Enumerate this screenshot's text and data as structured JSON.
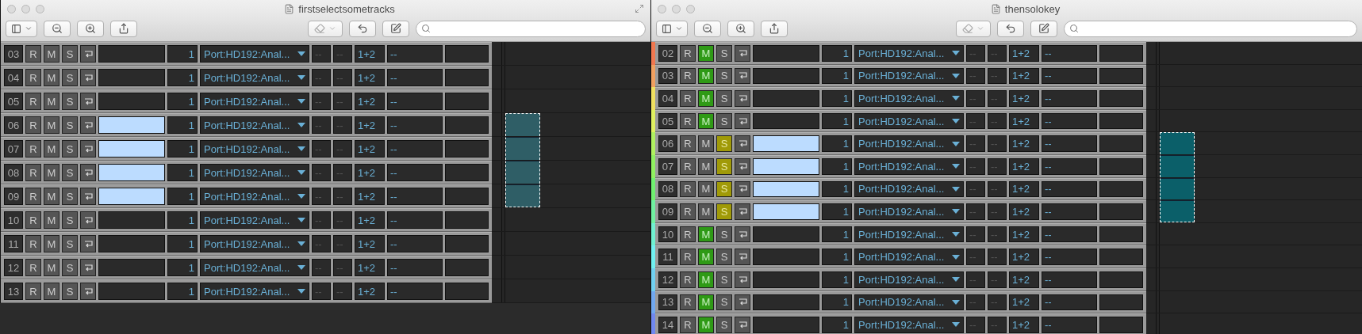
{
  "windows": [
    {
      "title": "firstselectsometracks",
      "tracks": [
        {
          "number": "03",
          "record": "R",
          "mute": "M",
          "solo": "S",
          "muted": false,
          "soloed": false,
          "selected": false,
          "input": "1",
          "port": "Port:HD192:Anal...",
          "send_a": "--",
          "send_b": "--",
          "channels": "1+2",
          "send_c": "--"
        },
        {
          "number": "04",
          "record": "R",
          "mute": "M",
          "solo": "S",
          "muted": false,
          "soloed": false,
          "selected": false,
          "input": "1",
          "port": "Port:HD192:Anal...",
          "send_a": "--",
          "send_b": "--",
          "channels": "1+2",
          "send_c": "--"
        },
        {
          "number": "05",
          "record": "R",
          "mute": "M",
          "solo": "S",
          "muted": false,
          "soloed": false,
          "selected": false,
          "input": "1",
          "port": "Port:HD192:Anal...",
          "send_a": "--",
          "send_b": "--",
          "channels": "1+2",
          "send_c": "--"
        },
        {
          "number": "06",
          "record": "R",
          "mute": "M",
          "solo": "S",
          "muted": false,
          "soloed": false,
          "selected": true,
          "input": "1",
          "port": "Port:HD192:Anal...",
          "send_a": "--",
          "send_b": "--",
          "channels": "1+2",
          "send_c": "--"
        },
        {
          "number": "07",
          "record": "R",
          "mute": "M",
          "solo": "S",
          "muted": false,
          "soloed": false,
          "selected": true,
          "input": "1",
          "port": "Port:HD192:Anal...",
          "send_a": "--",
          "send_b": "--",
          "channels": "1+2",
          "send_c": "--"
        },
        {
          "number": "08",
          "record": "R",
          "mute": "M",
          "solo": "S",
          "muted": false,
          "soloed": false,
          "selected": true,
          "input": "1",
          "port": "Port:HD192:Anal...",
          "send_a": "--",
          "send_b": "--",
          "channels": "1+2",
          "send_c": "--"
        },
        {
          "number": "09",
          "record": "R",
          "mute": "M",
          "solo": "S",
          "muted": false,
          "soloed": false,
          "selected": true,
          "input": "1",
          "port": "Port:HD192:Anal...",
          "send_a": "--",
          "send_b": "--",
          "channels": "1+2",
          "send_c": "--"
        },
        {
          "number": "10",
          "record": "R",
          "mute": "M",
          "solo": "S",
          "muted": false,
          "soloed": false,
          "selected": false,
          "input": "1",
          "port": "Port:HD192:Anal...",
          "send_a": "--",
          "send_b": "--",
          "channels": "1+2",
          "send_c": "--"
        },
        {
          "number": "11",
          "record": "R",
          "mute": "M",
          "solo": "S",
          "muted": false,
          "soloed": false,
          "selected": false,
          "input": "1",
          "port": "Port:HD192:Anal...",
          "send_a": "--",
          "send_b": "--",
          "channels": "1+2",
          "send_c": "--"
        },
        {
          "number": "12",
          "record": "R",
          "mute": "M",
          "solo": "S",
          "muted": false,
          "soloed": false,
          "selected": false,
          "input": "1",
          "port": "Port:HD192:Anal...",
          "send_a": "--",
          "send_b": "--",
          "channels": "1+2",
          "send_c": "--"
        },
        {
          "number": "13",
          "record": "R",
          "mute": "M",
          "solo": "S",
          "muted": false,
          "soloed": false,
          "selected": false,
          "input": "1",
          "port": "Port:HD192:Anal...",
          "send_a": "--",
          "send_b": "--",
          "channels": "1+2",
          "send_c": "--"
        }
      ]
    },
    {
      "title": "thensolokey",
      "tracks": [
        {
          "number": "02",
          "color": "#f07850",
          "record": "R",
          "mute": "M",
          "solo": "S",
          "muted": true,
          "soloed": false,
          "selected": false,
          "input": "1",
          "port": "Port:HD192:Anal...",
          "send_a": "--",
          "send_b": "--",
          "channels": "1+2",
          "send_c": "--"
        },
        {
          "number": "03",
          "color": "#f0a060",
          "record": "R",
          "mute": "M",
          "solo": "S",
          "muted": true,
          "soloed": false,
          "selected": false,
          "input": "1",
          "port": "Port:HD192:Anal...",
          "send_a": "--",
          "send_b": "--",
          "channels": "1+2",
          "send_c": "--"
        },
        {
          "number": "04",
          "color": "#f0e060",
          "record": "R",
          "mute": "M",
          "solo": "S",
          "muted": true,
          "soloed": false,
          "selected": false,
          "input": "1",
          "port": "Port:HD192:Anal...",
          "send_a": "--",
          "send_b": "--",
          "channels": "1+2",
          "send_c": "--"
        },
        {
          "number": "05",
          "color": "#e0f060",
          "record": "R",
          "mute": "M",
          "solo": "S",
          "muted": true,
          "soloed": false,
          "selected": false,
          "input": "1",
          "port": "Port:HD192:Anal...",
          "send_a": "--",
          "send_b": "--",
          "channels": "1+2",
          "send_c": "--"
        },
        {
          "number": "06",
          "color": "#b0f060",
          "record": "R",
          "mute": "M",
          "solo": "S",
          "muted": false,
          "soloed": true,
          "selected": true,
          "input": "1",
          "port": "Port:HD192:Anal...",
          "send_a": "--",
          "send_b": "--",
          "channels": "1+2",
          "send_c": "--"
        },
        {
          "number": "07",
          "color": "#90f060",
          "record": "R",
          "mute": "M",
          "solo": "S",
          "muted": false,
          "soloed": true,
          "selected": true,
          "input": "1",
          "port": "Port:HD192:Anal...",
          "send_a": "--",
          "send_b": "--",
          "channels": "1+2",
          "send_c": "--"
        },
        {
          "number": "08",
          "color": "#70f070",
          "record": "R",
          "mute": "M",
          "solo": "S",
          "muted": false,
          "soloed": true,
          "selected": true,
          "input": "1",
          "port": "Port:HD192:Anal...",
          "send_a": "--",
          "send_b": "--",
          "channels": "1+2",
          "send_c": "--"
        },
        {
          "number": "09",
          "color": "#70f0a0",
          "record": "R",
          "mute": "M",
          "solo": "S",
          "muted": false,
          "soloed": true,
          "selected": true,
          "input": "1",
          "port": "Port:HD192:Anal...",
          "send_a": "--",
          "send_b": "--",
          "channels": "1+2",
          "send_c": "--"
        },
        {
          "number": "10",
          "color": "#70f0d0",
          "record": "R",
          "mute": "M",
          "solo": "S",
          "muted": true,
          "soloed": false,
          "selected": false,
          "input": "1",
          "port": "Port:HD192:Anal...",
          "send_a": "--",
          "send_b": "--",
          "channels": "1+2",
          "send_c": "--"
        },
        {
          "number": "11",
          "color": "#70f0f0",
          "record": "R",
          "mute": "M",
          "solo": "S",
          "muted": true,
          "soloed": false,
          "selected": false,
          "input": "1",
          "port": "Port:HD192:Anal...",
          "send_a": "--",
          "send_b": "--",
          "channels": "1+2",
          "send_c": "--"
        },
        {
          "number": "12",
          "color": "#70d0f0",
          "record": "R",
          "mute": "M",
          "solo": "S",
          "muted": true,
          "soloed": false,
          "selected": false,
          "input": "1",
          "port": "Port:HD192:Anal...",
          "send_a": "--",
          "send_b": "--",
          "channels": "1+2",
          "send_c": "--"
        },
        {
          "number": "13",
          "color": "#70a8f0",
          "record": "R",
          "mute": "M",
          "solo": "S",
          "muted": true,
          "soloed": false,
          "selected": false,
          "input": "1",
          "port": "Port:HD192:Anal...",
          "send_a": "--",
          "send_b": "--",
          "channels": "1+2",
          "send_c": "--"
        },
        {
          "number": "14",
          "color": "#7088f0",
          "record": "R",
          "mute": "M",
          "solo": "S",
          "muted": true,
          "soloed": false,
          "selected": false,
          "input": "1",
          "port": "Port:HD192:Anal...",
          "send_a": "--",
          "send_b": "--",
          "channels": "1+2",
          "send_c": "--"
        }
      ]
    }
  ]
}
